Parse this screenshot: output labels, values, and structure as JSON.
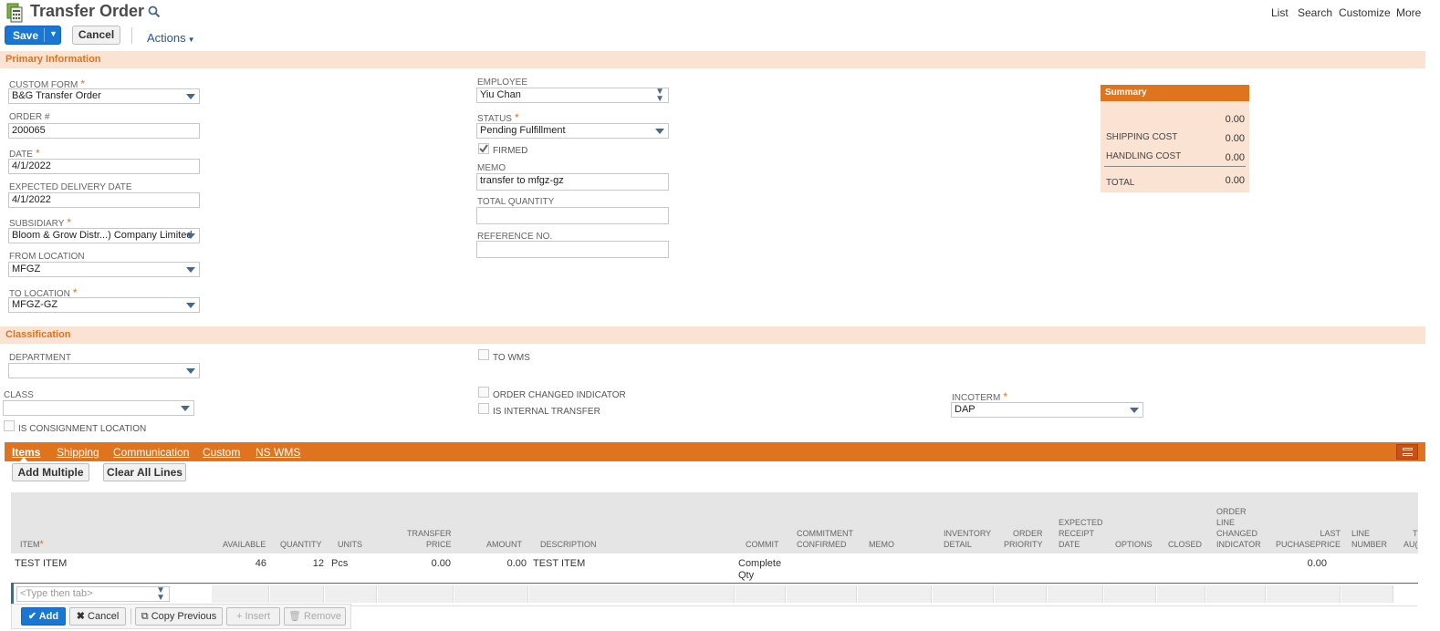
{
  "header": {
    "title": "Transfer Order",
    "nav": [
      "List",
      "Search",
      "Customize",
      "More"
    ]
  },
  "toolbar": {
    "save": "Save",
    "cancel": "Cancel",
    "actions": "Actions"
  },
  "primary": {
    "section_title": "Primary Information",
    "custom_form": {
      "label": "CUSTOM FORM",
      "value": "B&G Transfer Order"
    },
    "order_no": {
      "label": "ORDER #",
      "value": "200065"
    },
    "date": {
      "label": "DATE",
      "value": "4/1/2022"
    },
    "expected_delivery": {
      "label": "EXPECTED DELIVERY DATE",
      "value": "4/1/2022"
    },
    "subsidiary": {
      "label": "SUBSIDIARY",
      "value": "Bloom & Grow Distr...) Company Limited"
    },
    "from_location": {
      "label": "FROM LOCATION",
      "value": "MFGZ"
    },
    "to_location": {
      "label": "TO LOCATION",
      "value": "MFGZ-GZ"
    },
    "employee": {
      "label": "EMPLOYEE",
      "value": "Yiu Chan"
    },
    "status": {
      "label": "STATUS",
      "value": "Pending Fulfillment"
    },
    "firmed": {
      "label": "FIRMED"
    },
    "memo": {
      "label": "MEMO",
      "value": "transfer to mfgz-gz"
    },
    "total_quantity": {
      "label": "TOTAL QUANTITY",
      "value": ""
    },
    "reference_no": {
      "label": "REFERENCE NO.",
      "value": ""
    }
  },
  "summary": {
    "title": "Summary",
    "subtotal": "0.00",
    "shipping_label": "SHIPPING COST",
    "shipping": "0.00",
    "handling_label": "HANDLING COST",
    "handling": "0.00",
    "total_label": "TOTAL",
    "total": "0.00"
  },
  "classification": {
    "section_title": "Classification",
    "department": {
      "label": "DEPARTMENT",
      "value": ""
    },
    "class": {
      "label": "CLASS",
      "value": ""
    },
    "is_consignment": {
      "label": "IS CONSIGNMENT LOCATION"
    },
    "to_wms": {
      "label": "TO WMS"
    },
    "order_changed": {
      "label": "ORDER CHANGED INDICATOR"
    },
    "is_internal": {
      "label": "IS INTERNAL TRANSFER"
    },
    "incoterm": {
      "label": "INCOTERM",
      "value": "DAP"
    }
  },
  "tabs": [
    "Items",
    "Shipping",
    "Communication",
    "Custom",
    "NS WMS"
  ],
  "items": {
    "add_multiple": "Add Multiple",
    "clear_all": "Clear All Lines",
    "columns": {
      "item": "ITEM",
      "available": "AVAILABLE",
      "quantity": "QUANTITY",
      "units": "UNITS",
      "transfer_price_1": "TRANSFER",
      "transfer_price_2": "PRICE",
      "amount": "AMOUNT",
      "description": "DESCRIPTION",
      "commit": "COMMIT",
      "commitment_1": "COMMITMENT",
      "commitment_2": "CONFIRMED",
      "memo": "MEMO",
      "inventory_1": "INVENTORY",
      "inventory_2": "DETAIL",
      "priority_1": "ORDER",
      "priority_2": "PRIORITY",
      "expected_1": "EXPECTED",
      "expected_2": "RECEIPT",
      "expected_3": "DATE",
      "options": "OPTIONS",
      "closed": "CLOSED",
      "olci_1": "ORDER",
      "olci_2": "LINE",
      "olci_3": "CHANGED",
      "olci_4": "INDICATOR",
      "last_1": "LAST",
      "last_2": "PUCHASEPRICE",
      "line_1": "LINE",
      "line_2": "NUMBER",
      "extra_1": "T",
      "extra_2": "AU("
    },
    "row": {
      "item": "TEST ITEM",
      "available": "46",
      "quantity": "12",
      "units": "Pcs",
      "transfer_price": "0.00",
      "amount": "0.00",
      "description": "TEST ITEM",
      "commit_1": "Complete",
      "commit_2": "Qty",
      "last_price": "0.00"
    },
    "edit_placeholder": "<Type then tab>",
    "btn_add": "Add",
    "btn_cancel": "Cancel",
    "btn_copy": "Copy Previous",
    "btn_insert": "Insert",
    "btn_remove": "Remove"
  }
}
